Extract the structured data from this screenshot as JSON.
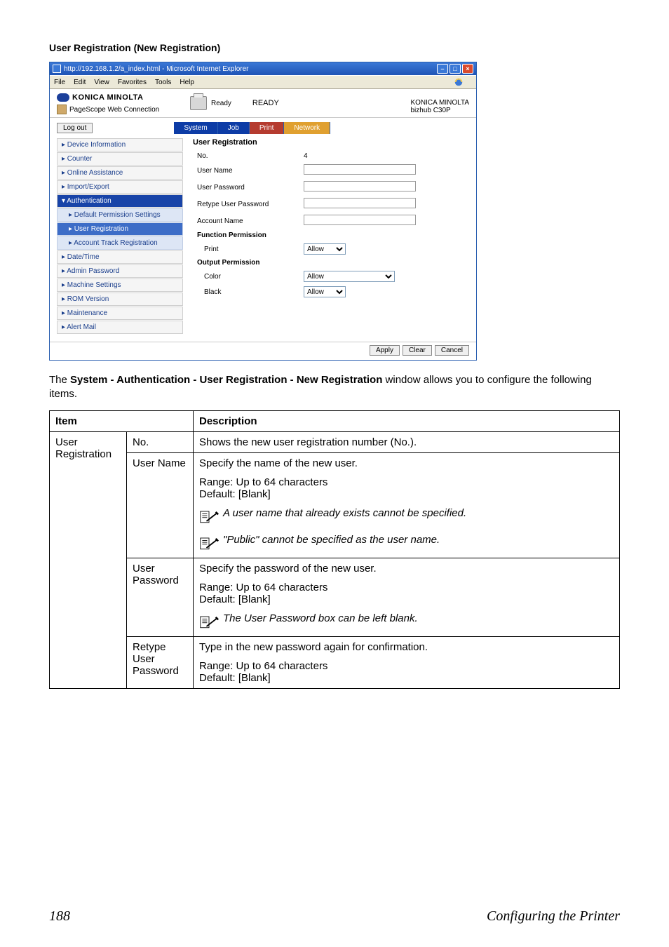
{
  "section_title": "User Registration (New Registration)",
  "ie": {
    "title": "http://192.168.1.2/a_index.html - Microsoft Internet Explorer",
    "menu": {
      "file": "File",
      "edit": "Edit",
      "view": "View",
      "favorites": "Favorites",
      "tools": "Tools",
      "help": "Help"
    }
  },
  "header": {
    "brand": "KONICA MINOLTA",
    "product": "PageScope Web Connection",
    "status_label": "Ready",
    "status_value": "READY",
    "right1": "KONICA MINOLTA",
    "right2": "bizhub C30P"
  },
  "logout": "Log out",
  "tabs": {
    "system": "System",
    "job": "Job",
    "print": "Print",
    "network": "Network"
  },
  "sidebar": {
    "device_info": "▸ Device Information",
    "counter": "▸ Counter",
    "online": "▸ Online Assistance",
    "import": "▸ Import/Export",
    "auth": "▾ Authentication",
    "default_perm": "▸ Default Permission Settings",
    "user_reg": "▸ User Registration",
    "acct_track": "▸ Account Track Registration",
    "datetime": "▸ Date/Time",
    "admin_pw": "▸ Admin Password",
    "machine": "▸ Machine Settings",
    "rom": "▸ ROM Version",
    "maint": "▸ Maintenance",
    "alert": "▸ Alert Mail"
  },
  "content": {
    "title": "User Registration",
    "labels": {
      "no": "No.",
      "no_val": "4",
      "user_name": "User Name",
      "user_pw": "User Password",
      "retype_pw": "Retype User Password",
      "account": "Account Name",
      "func_perm": "Function Permission",
      "print": "Print",
      "out_perm": "Output Permission",
      "color": "Color",
      "black": "Black"
    },
    "allow": "Allow"
  },
  "footer_buttons": {
    "apply": "Apply",
    "clear": "Clear",
    "cancel": "Cancel"
  },
  "body_text_pre": "The ",
  "body_text_bold": "System - Authentication - User Registration - New Registration",
  "body_text_post": " window allows you to configure the following items.",
  "table": {
    "h_item": "Item",
    "h_desc": "Description",
    "group": "User Registration",
    "rows": {
      "no": {
        "label": "No.",
        "desc": "Shows the new user registration number (No.)."
      },
      "user_name": {
        "label": "User Name",
        "line1": "Specify the name of the new user.",
        "range": "Range:   Up to 64 characters",
        "default": "Default:   [Blank]",
        "note1": "A user name that already exists cannot be specified.",
        "note2": "\"Public\" cannot be specified as the user name."
      },
      "user_pw": {
        "label": "User Password",
        "line1": "Specify the password of the new user.",
        "range": "Range:   Up to 64 characters",
        "default": "Default:   [Blank]",
        "note1": "The User Password box can be left blank."
      },
      "retype": {
        "label": "Retype User Password",
        "line1": "Type in the new password again for confirmation.",
        "range": "Range:   Up to 64 characters",
        "default": "Default:   [Blank]"
      }
    }
  },
  "page_footer": {
    "num": "188",
    "title": "Configuring the Printer"
  }
}
